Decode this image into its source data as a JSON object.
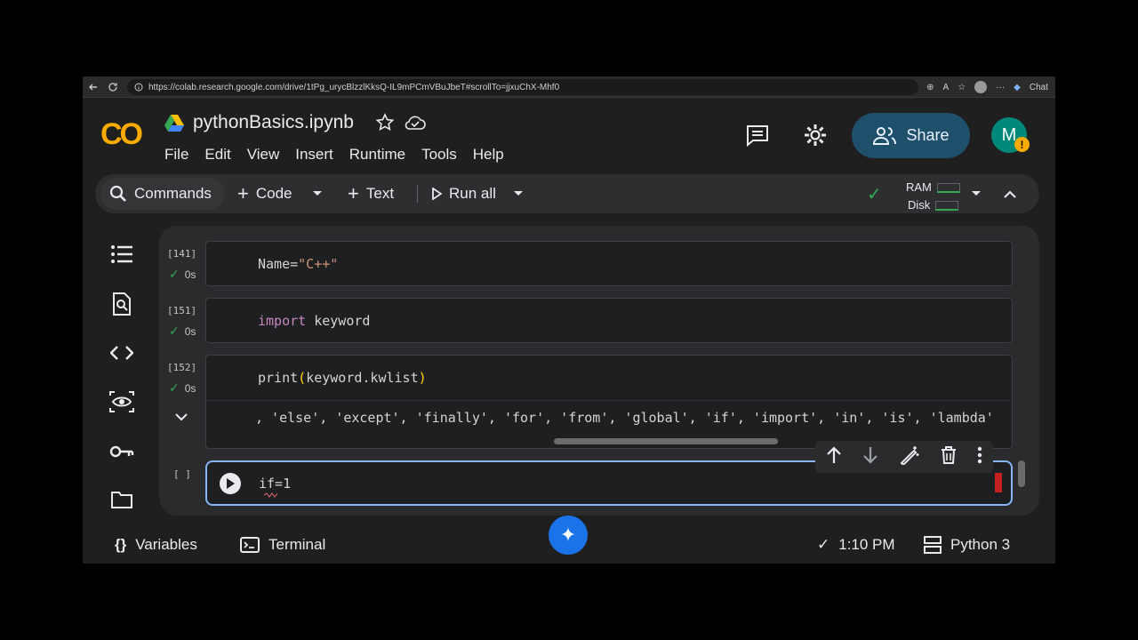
{
  "browser": {
    "url": "https://colab.research.google.com/drive/1tPg_urycBlzzlKksQ-IL9mPCmVBuJbeT#scrollTo=jjxuChX-Mhf0",
    "chat_label": "Chat"
  },
  "header": {
    "logo": "CO",
    "notebook_title": "pythonBasics.ipynb",
    "menu": [
      "File",
      "Edit",
      "View",
      "Insert",
      "Runtime",
      "Tools",
      "Help"
    ],
    "share_label": "Share",
    "avatar_initial": "M",
    "avatar_warning": "!"
  },
  "toolbar": {
    "commands_label": "Commands",
    "code_label": "Code",
    "text_label": "Text",
    "run_all_label": "Run all",
    "ram_label": "RAM",
    "disk_label": "Disk"
  },
  "cells": [
    {
      "exec_count": "[141]",
      "time": "0s",
      "code_prefix": "Name=",
      "code_string": "\"C++\""
    },
    {
      "exec_count": "[151]",
      "time": "0s",
      "code_keyword": "import",
      "code_rest": " keyword"
    },
    {
      "exec_count": "[152]",
      "time": "0s",
      "code_fn": "print",
      "code_open": "(",
      "code_arg": "keyword.kwlist",
      "code_close": ")",
      "output": ", 'else', 'except', 'finally', 'for', 'from', 'global', 'if', 'import', 'in', 'is', 'lambda'"
    },
    {
      "exec_count": "[ ]",
      "code": "if=1"
    }
  ],
  "statusbar": {
    "variables_label": "Variables",
    "terminal_label": "Terminal",
    "time": "1:10 PM",
    "runtime": "Python 3"
  },
  "colors": {
    "accent": "#8ab4f8",
    "share_bg": "#1e4f6b",
    "check": "#34a853",
    "logo_yellow": "#f9ab00",
    "logo_orange": "#e37400"
  }
}
